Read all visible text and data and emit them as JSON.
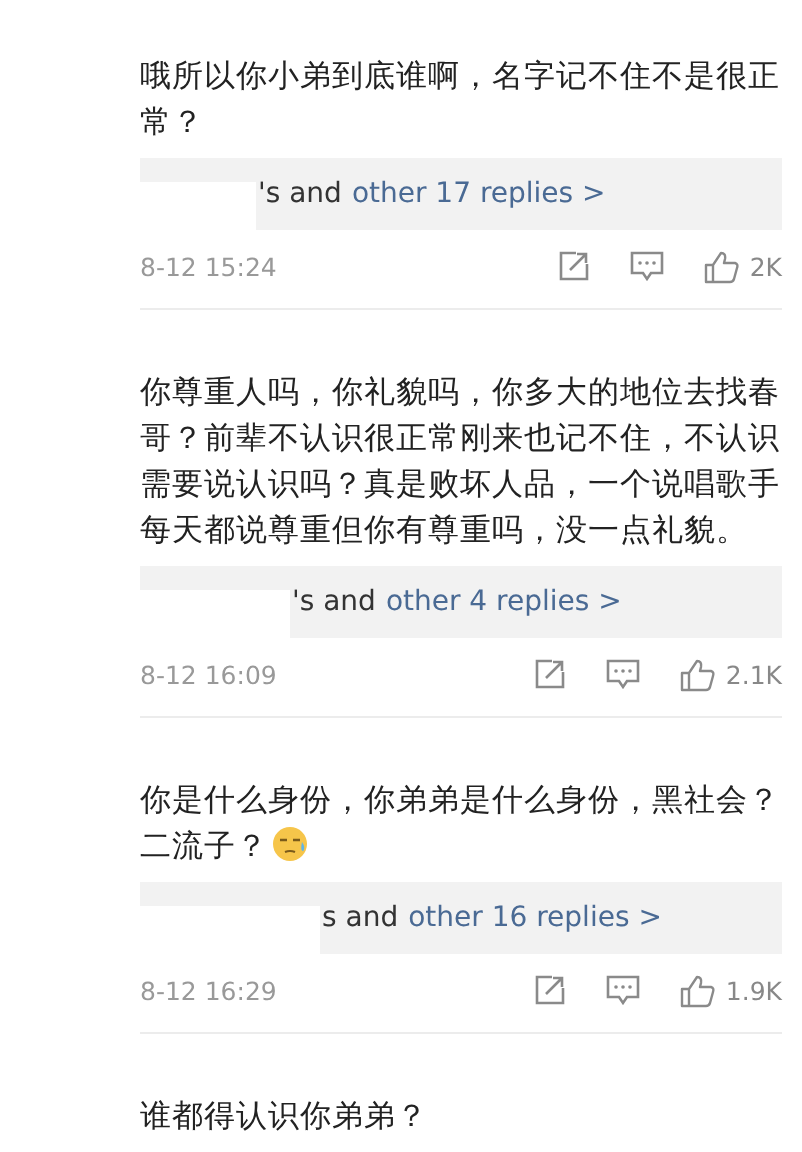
{
  "comments": [
    {
      "text": "哦所以你小弟到底谁啊，名字记不住不是很正常？",
      "replies": {
        "prefix": "'s and",
        "link": "other 17 replies >"
      },
      "time": "8-12 15:24",
      "likes": "2K"
    },
    {
      "text": "你尊重人吗，你礼貌吗，你多大的地位去找春哥？前辈不认识很正常刚来也记不住，不认识需要说认识吗？真是败坏人品，一个说唱歌手每天都说尊重但你有尊重吗，没一点礼貌。",
      "replies": {
        "prefix": "'s and",
        "link": "other 4 replies >"
      },
      "time": "8-12 16:09",
      "likes": "2.1K"
    },
    {
      "text": "你是什么身份，你弟弟是什么身份，黑社会？二流子？",
      "emoji": true,
      "replies": {
        "prefix": "s and",
        "link": "other 16 replies >"
      },
      "time": "8-12 16:29",
      "likes": "1.9K"
    },
    {
      "text": "谁都得认识你弟弟？"
    }
  ]
}
